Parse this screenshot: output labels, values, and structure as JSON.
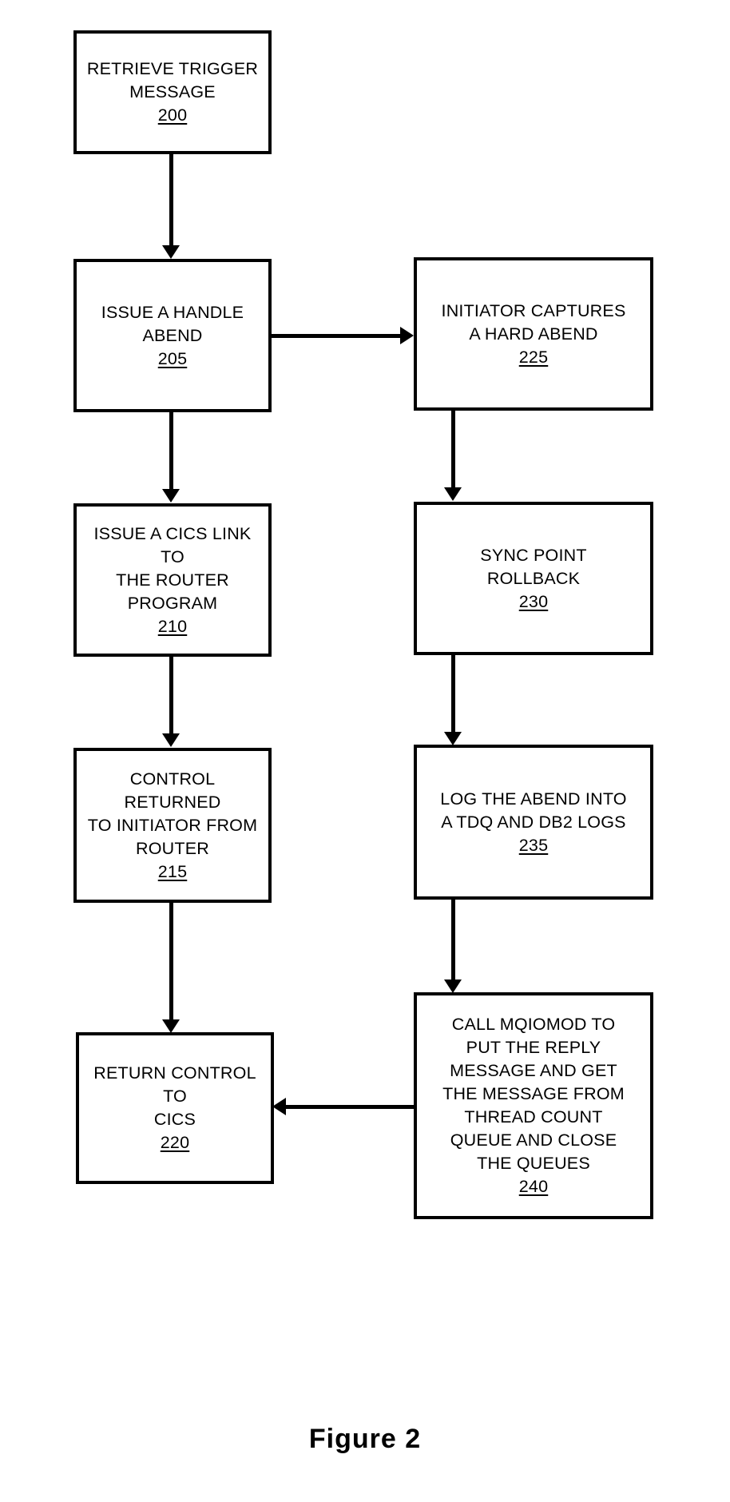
{
  "figure": {
    "caption": "Figure 2"
  },
  "nodes": [
    {
      "id": "n200",
      "label": "RETRIEVE TRIGGER\nMESSAGE",
      "ref": "200"
    },
    {
      "id": "n205",
      "label": "ISSUE A HANDLE\nABEND",
      "ref": "205"
    },
    {
      "id": "n225",
      "label": "INITIATOR CAPTURES\nA HARD ABEND",
      "ref": "225"
    },
    {
      "id": "n210",
      "label": "ISSUE A CICS LINK TO\nTHE ROUTER\nPROGRAM",
      "ref": "210"
    },
    {
      "id": "n230",
      "label": "SYNC POINT\nROLLBACK",
      "ref": "230"
    },
    {
      "id": "n215",
      "label": "CONTROL RETURNED\nTO INITIATOR FROM\nROUTER",
      "ref": "215"
    },
    {
      "id": "n235",
      "label": "LOG THE ABEND INTO\nA TDQ AND DB2 LOGS",
      "ref": "235"
    },
    {
      "id": "n220",
      "label": "RETURN CONTROL TO\nCICS",
      "ref": "220"
    },
    {
      "id": "n240",
      "label": "CALL MQIOMOD TO\nPUT THE REPLY\nMESSAGE AND GET\nTHE MESSAGE FROM\nTHREAD COUNT\nQUEUE AND CLOSE\nTHE QUEUES",
      "ref": "240"
    }
  ],
  "edges": [
    {
      "id": "e200-205",
      "from": "200",
      "to": "205",
      "direction": "down"
    },
    {
      "id": "e205-225",
      "from": "205",
      "to": "225",
      "direction": "right"
    },
    {
      "id": "e205-210",
      "from": "205",
      "to": "210",
      "direction": "down"
    },
    {
      "id": "e225-230",
      "from": "225",
      "to": "230",
      "direction": "down"
    },
    {
      "id": "e210-215",
      "from": "210",
      "to": "215",
      "direction": "down"
    },
    {
      "id": "e230-235",
      "from": "230",
      "to": "235",
      "direction": "down"
    },
    {
      "id": "e215-220",
      "from": "215",
      "to": "220",
      "direction": "down"
    },
    {
      "id": "e235-240",
      "from": "235",
      "to": "240",
      "direction": "down"
    },
    {
      "id": "e240-220",
      "from": "240",
      "to": "220",
      "direction": "left"
    }
  ],
  "colors": {
    "stroke": "#000000",
    "fill": "#ffffff",
    "text": "#000000"
  }
}
